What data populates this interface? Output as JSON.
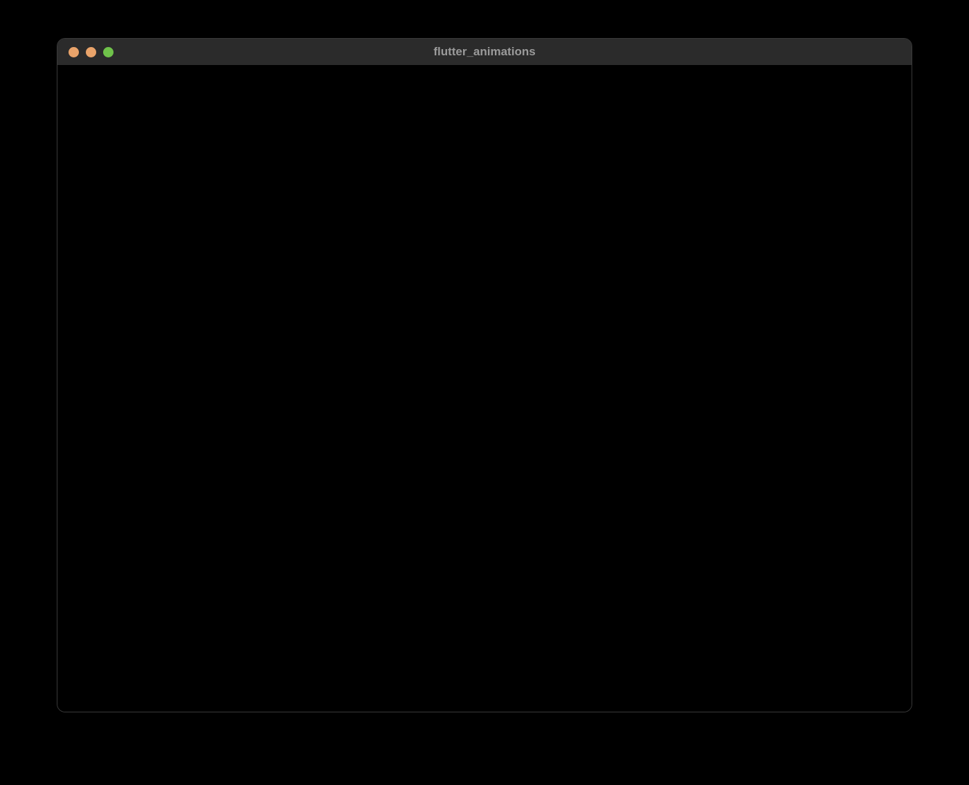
{
  "window": {
    "title": "flutter_animations",
    "traffic_lights": {
      "close_color": "#e9a36a",
      "minimize_color": "#e9a36a",
      "maximize_color": "#6fc24a"
    }
  }
}
